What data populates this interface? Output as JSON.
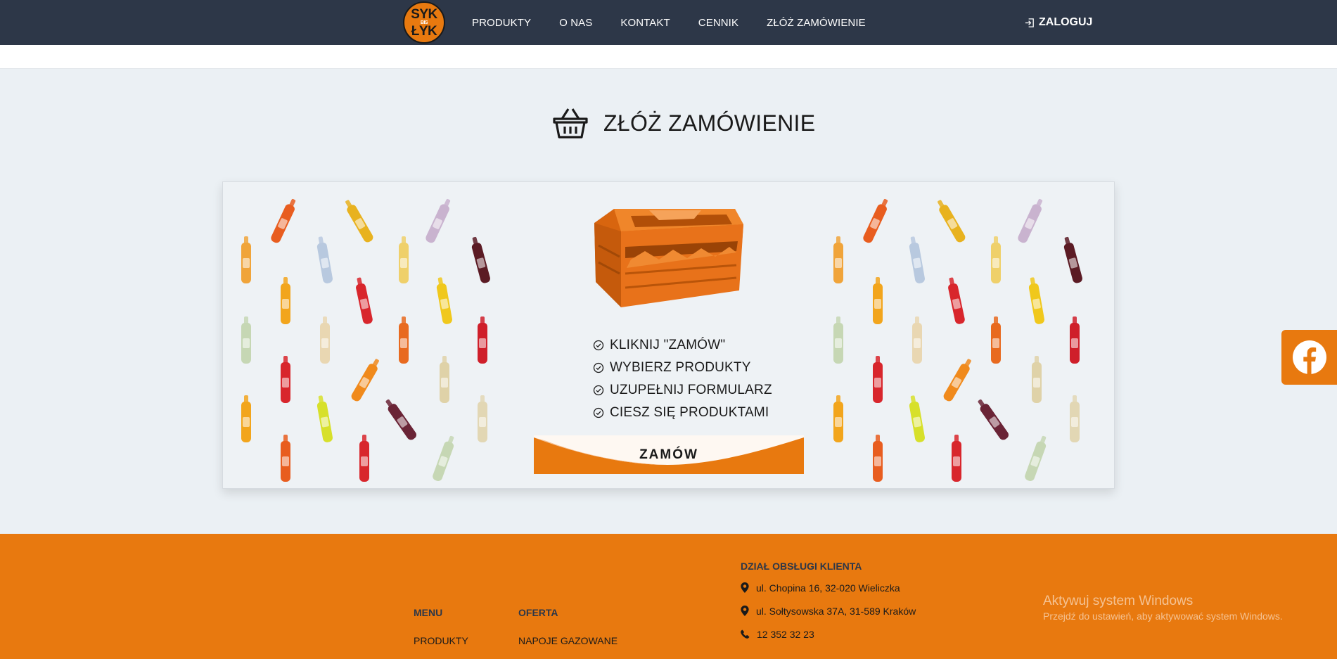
{
  "navbar": {
    "logo_top": "SYK",
    "logo_mid": "BIS",
    "logo_bottom": "ŁYK",
    "links": [
      "PRODUKTY",
      "O NAS",
      "KONTAKT",
      "CENNIK",
      "ZŁÓŻ ZAMÓWIENIE"
    ],
    "login_label": "ZALOGUJ",
    "background": "#2d3748"
  },
  "main": {
    "title": "ZŁÓŻ ZAMÓWIENIE",
    "title_icon": "basket-icon",
    "steps": [
      "KLIKNIJ \"ZAMÓW\"",
      "WYBIERZ PRODUKTY",
      "UZUPEŁNIJ FORMULARZ",
      "CIESZ SIĘ PRODUKTAMI"
    ],
    "step_icon": "check-circle-icon",
    "order_button_label": "ZAMÓW",
    "accent": "#e8790f"
  },
  "social": {
    "facebook_icon": "facebook-icon"
  },
  "footer": {
    "menu": {
      "heading": "MENU",
      "items": [
        "PRODUKTY"
      ]
    },
    "offer": {
      "heading": "OFERTA",
      "items": [
        "NAPOJE GAZOWANE"
      ]
    },
    "customer_service": {
      "heading": "DZIAŁ OBSŁUGI KLIENTA",
      "address_1": "ul. Chopina 16, 32-020 Wieliczka",
      "address_2": "ul. Sołtysowska 37A, 31-589 Kraków",
      "phone": "12 352 32 23"
    },
    "background": "#e8790f"
  },
  "watermark": {
    "line1": "Aktywuj system Windows",
    "line2": "Przejdź do ustawień, aby aktywować system Windows."
  }
}
